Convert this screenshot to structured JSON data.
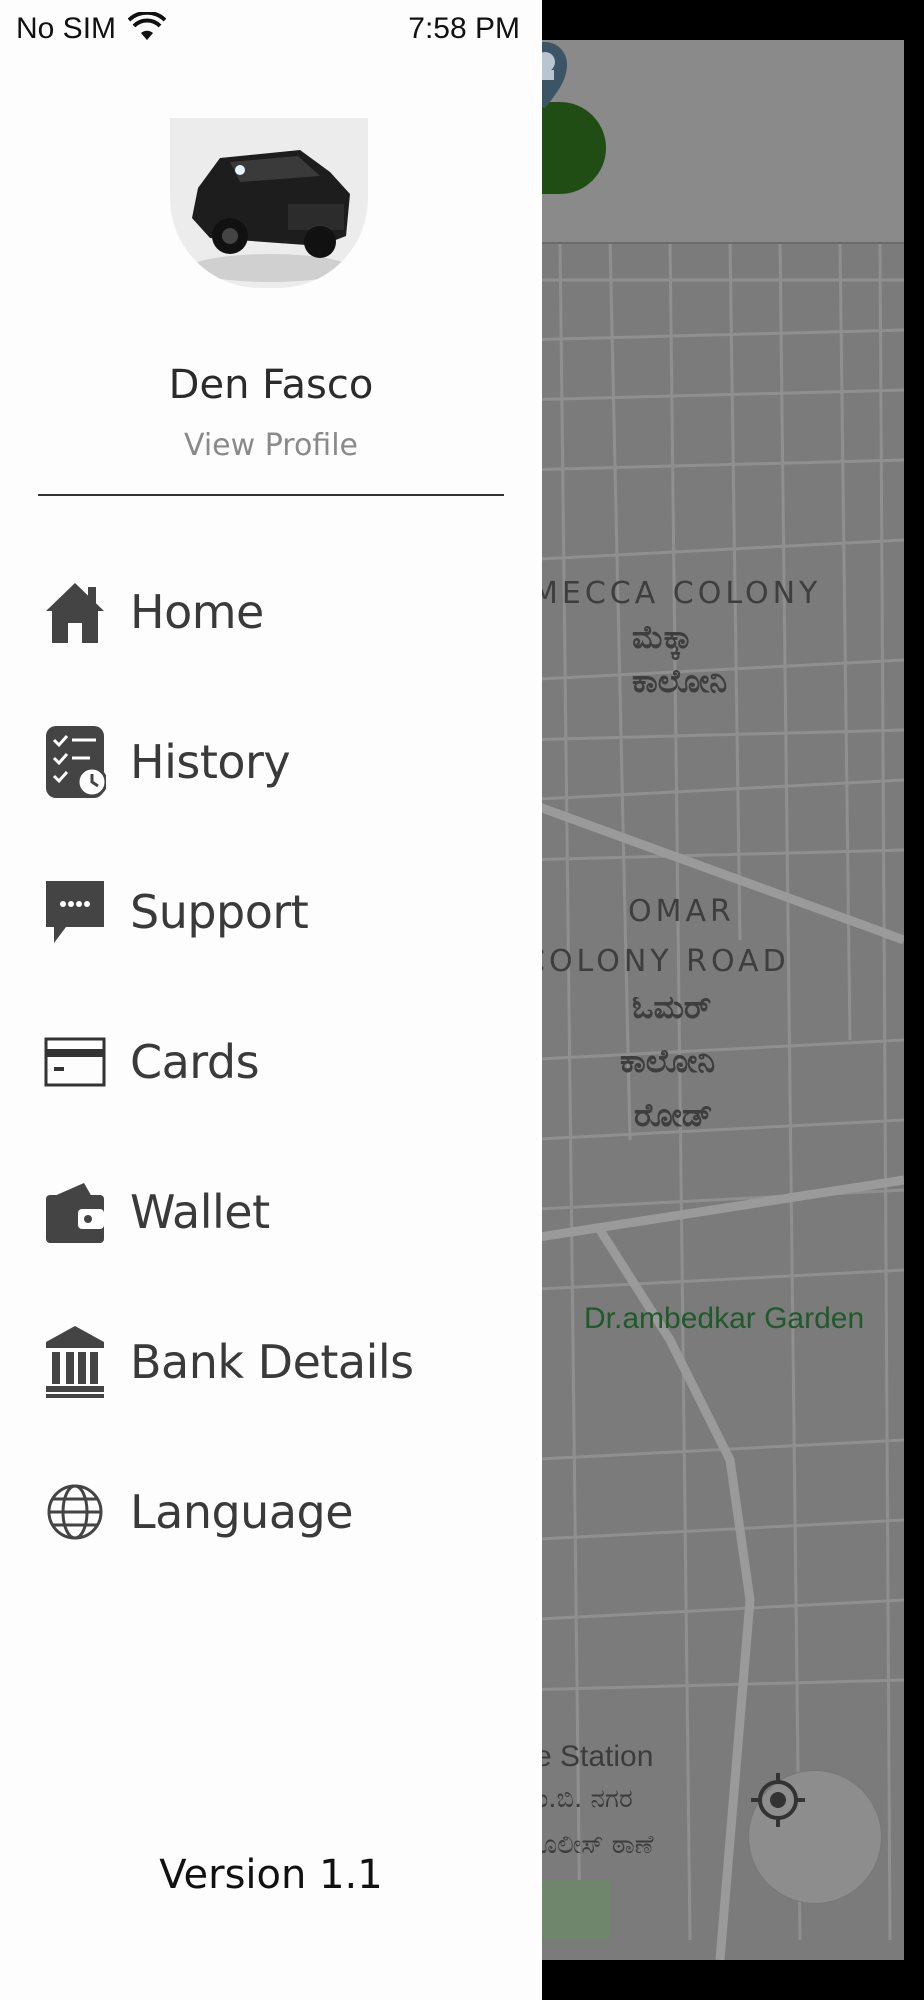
{
  "status_bar": {
    "carrier": "No SIM",
    "time": "7:58 PM"
  },
  "profile": {
    "name": "Den Fasco",
    "view_profile_label": "View Profile"
  },
  "menu": {
    "items": [
      {
        "label": "Home",
        "icon": "home-icon"
      },
      {
        "label": "History",
        "icon": "history-icon"
      },
      {
        "label": "Support",
        "icon": "support-chat-icon"
      },
      {
        "label": "Cards",
        "icon": "card-icon"
      },
      {
        "label": "Wallet",
        "icon": "wallet-icon"
      },
      {
        "label": "Bank Details",
        "icon": "bank-icon"
      },
      {
        "label": "Language",
        "icon": "globe-icon"
      }
    ]
  },
  "version": "Version 1.1",
  "map": {
    "labels": {
      "mecca_en": "MECCA COLONY",
      "mecca_kn1": "ಮೆಕ್ಕಾ",
      "mecca_kn2": "ಕಾಲೋನಿ",
      "omar_en1": "OMAR",
      "omar_en2": "COLONY ROAD",
      "omar_kn1": "ಓಮರ್",
      "omar_kn2": "ಕಾಲೋನಿ",
      "omar_kn3": "ರೋಡ್",
      "garden": "Dr.ambedkar Garden",
      "station": "ce Station",
      "station_kn1": "ಎಂ.ಬಿ. ನಗರ",
      "station_kn2": "ೂಲೀಸ್ ಠಾಣೆ"
    }
  },
  "colors": {
    "drawer_bg": "#fdfdfd",
    "map_overlay": "#7b7b7b",
    "accent_green": "#1f4d14",
    "text_primary": "#3a3a3a"
  }
}
